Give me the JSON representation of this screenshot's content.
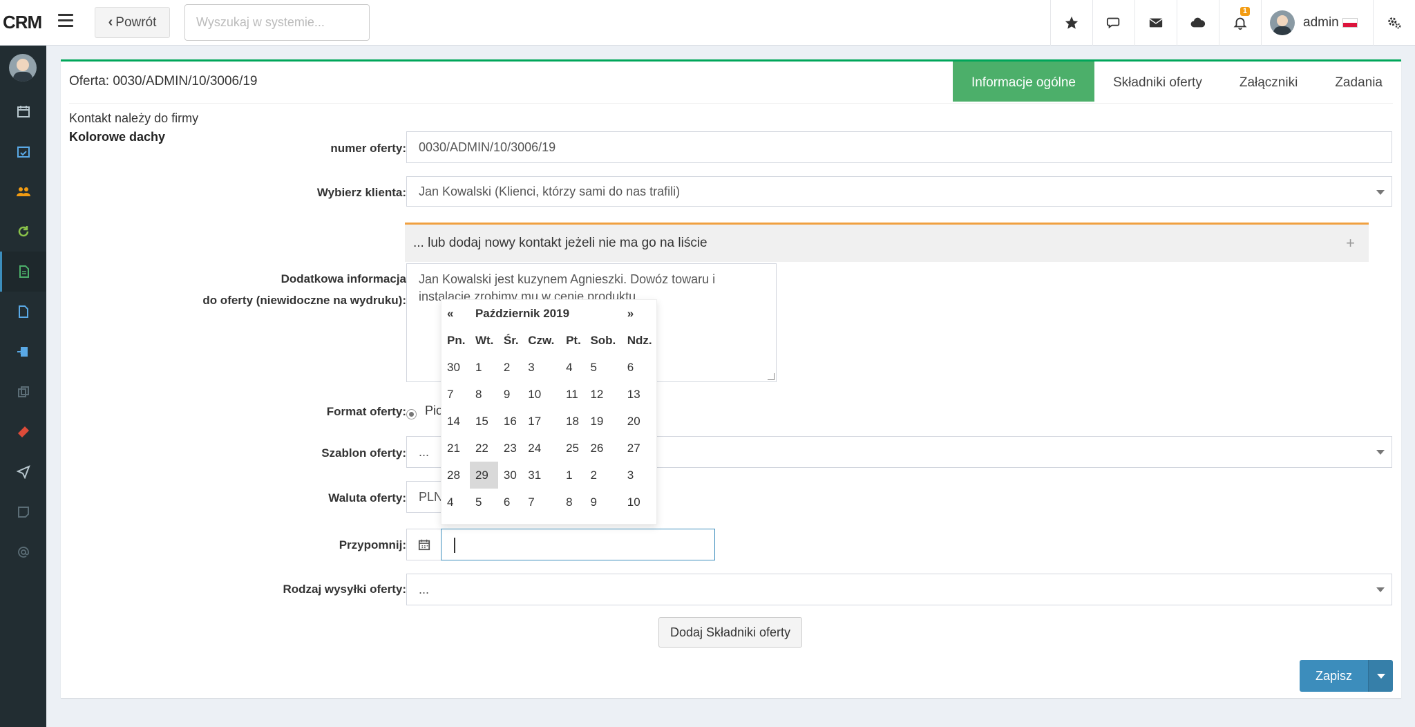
{
  "header": {
    "logo": "CRM",
    "back_label": "Powrót",
    "search_placeholder": "Wyszukaj w systemie...",
    "notification_count": "1",
    "user_name": "admin"
  },
  "sidebar": {
    "items": [
      "calendar-icon",
      "calendar-check-icon",
      "users-icon",
      "refresh-icon",
      "document-icon",
      "pdf-icon",
      "import-icon",
      "copy-icon",
      "ticket-icon",
      "send-icon",
      "note-icon",
      "at-icon"
    ],
    "active_index": 4
  },
  "panel": {
    "title": "Oferta: 0030/ADMIN/10/3006/19",
    "tabs": [
      "Informacje ogólne",
      "Składniki oferty",
      "Załączniki",
      "Zadania"
    ],
    "active_tab": "Informacje ogólne",
    "contact_note": "Kontakt należy do firmy",
    "company": "Kolorowe dachy"
  },
  "form": {
    "offer_number_label": "numer oferty:",
    "offer_number_value": "0030/ADMIN/10/3006/19",
    "client_label": "Wybierz klienta:",
    "client_value": "Jan Kowalski (Klienci, którzy sami do nas trafili)",
    "new_contact_label": "... lub dodaj nowy kontakt jeżeli nie ma go na liście",
    "extra_info_label_1": "Dodatkowa informacja",
    "extra_info_label_2": "do oferty (niewidoczne na wydruku):",
    "extra_info_value": "Jan Kowalski jest kuzynem Agnieszki.  Dowóz towaru i instalację zrobimy mu w cenie produktu.",
    "format_label": "Format oferty:",
    "format_option": "Pio",
    "template_label": "Szablon oferty:",
    "template_value": "...",
    "currency_label": "Waluta oferty:",
    "currency_value": "PLN",
    "remind_label": "Przypomnij:",
    "remind_value": "",
    "shipping_label": "Rodzaj wysyłki oferty:",
    "shipping_value": "...",
    "add_items_button": "Dodaj Składniki oferty",
    "save_button": "Zapisz"
  },
  "datepicker": {
    "prev": "«",
    "next": "»",
    "month": "Październik 2019",
    "weekdays": [
      "Pn.",
      "Wt.",
      "Śr.",
      "Czw.",
      "Pt.",
      "Sob.",
      "Ndz."
    ],
    "weeks": [
      [
        "30",
        "1",
        "2",
        "3",
        "4",
        "5",
        "6"
      ],
      [
        "7",
        "8",
        "9",
        "10",
        "11",
        "12",
        "13"
      ],
      [
        "14",
        "15",
        "16",
        "17",
        "18",
        "19",
        "20"
      ],
      [
        "21",
        "22",
        "23",
        "24",
        "25",
        "26",
        "27"
      ],
      [
        "28",
        "29",
        "30",
        "31",
        "1",
        "2",
        "3"
      ],
      [
        "4",
        "5",
        "6",
        "7",
        "8",
        "9",
        "10"
      ]
    ],
    "selected": "29"
  },
  "colors": {
    "accent_green": "#00a65a",
    "tab_active": "#4caf6a",
    "primary_blue": "#3c8dbc",
    "sidebar_bg": "#222d32",
    "new_contact_border": "#f0a040"
  }
}
